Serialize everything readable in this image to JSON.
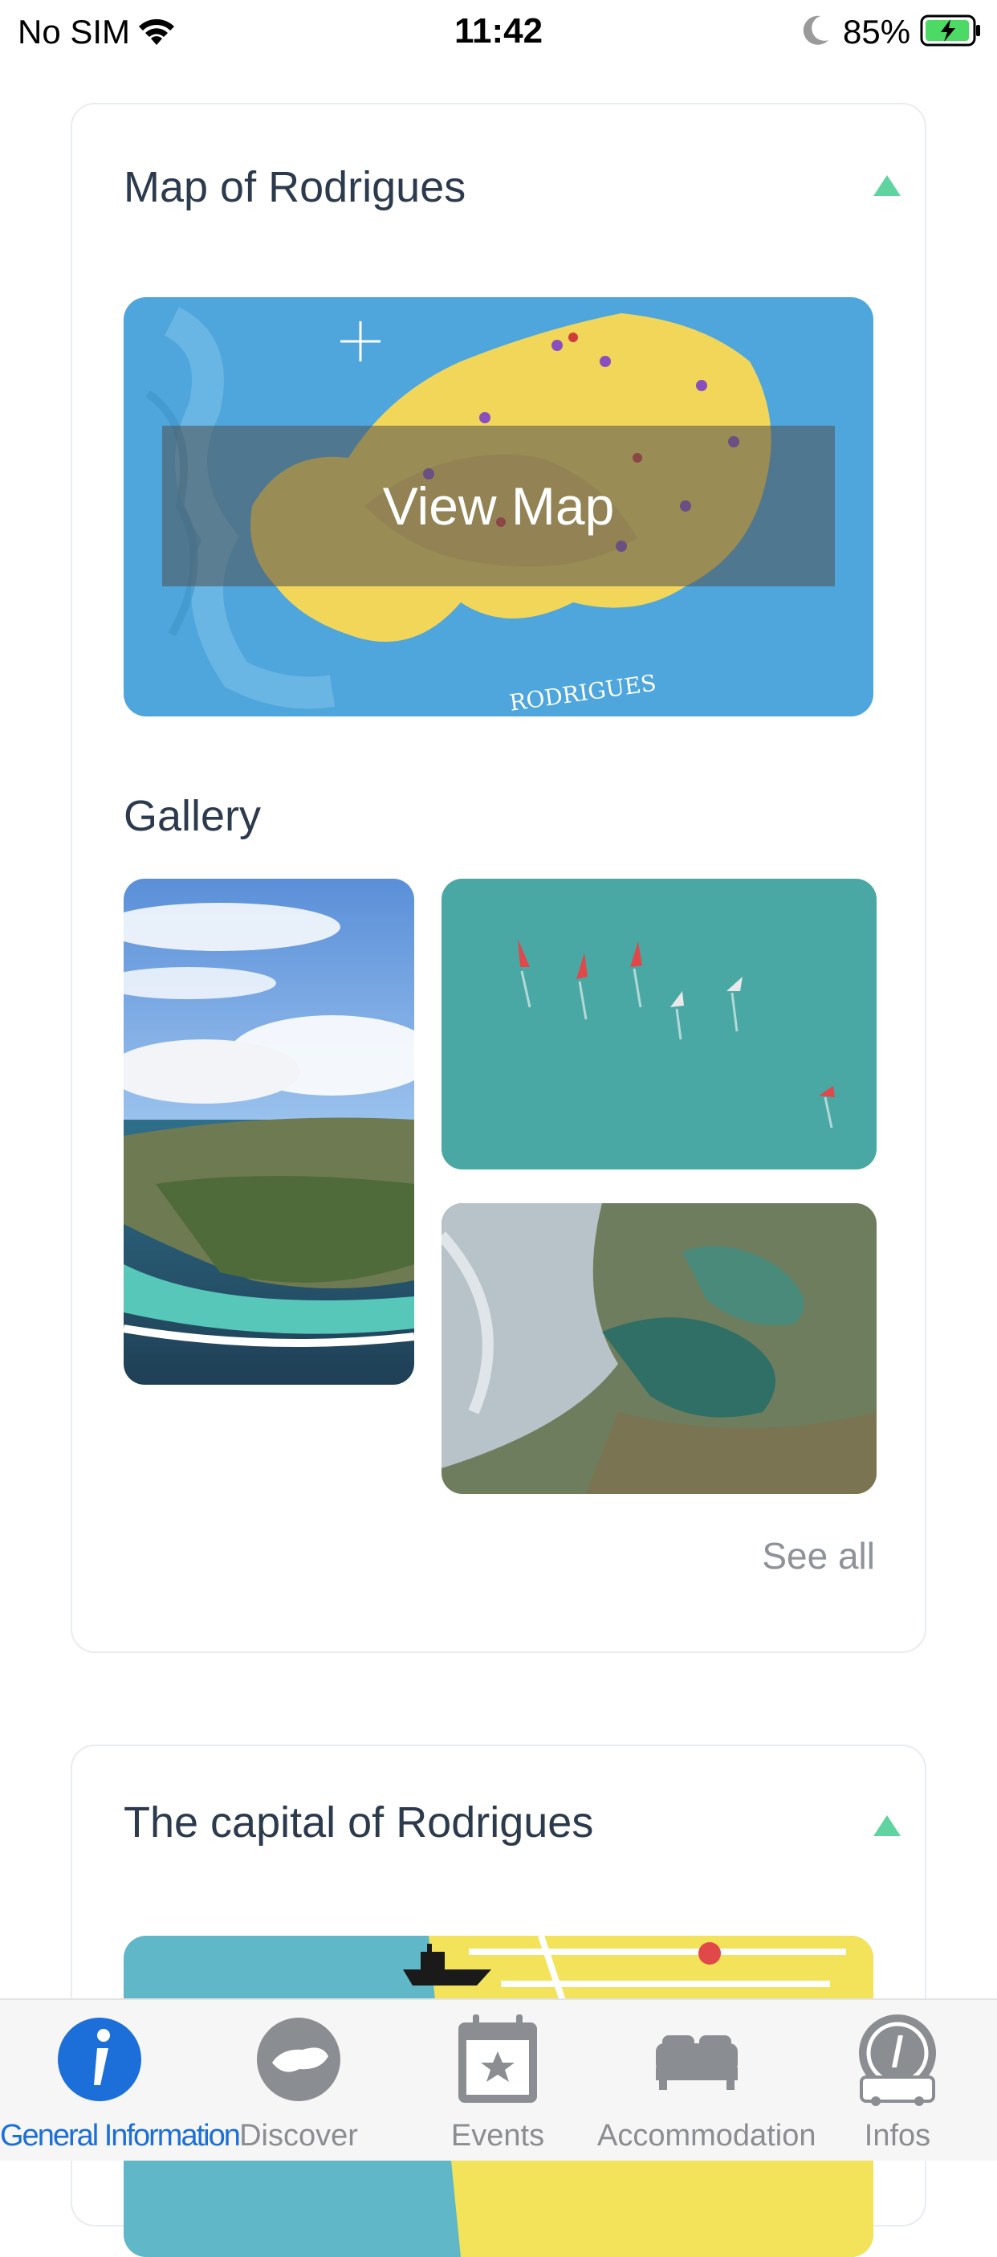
{
  "status_bar": {
    "carrier": "No SIM",
    "time": "11:42",
    "battery": "85%"
  },
  "map_section": {
    "title": "Map of Rodrigues",
    "button_label": "View Map"
  },
  "gallery": {
    "title": "Gallery",
    "see_all": "See all"
  },
  "capital_section": {
    "title": "The capital of Rodrigues"
  },
  "tabs": [
    {
      "label": "General Information",
      "icon": "info-icon",
      "active": true
    },
    {
      "label": "Discover",
      "icon": "island-icon",
      "active": false
    },
    {
      "label": "Events",
      "icon": "calendar-star-icon",
      "active": false
    },
    {
      "label": "Accommodation",
      "icon": "bed-icon",
      "active": false
    },
    {
      "label": "Infos",
      "icon": "info-bus-icon",
      "active": false
    }
  ],
  "colors": {
    "accent": "#1c6fd8",
    "caret": "#5fd4a1",
    "title": "#2c3a4d"
  }
}
